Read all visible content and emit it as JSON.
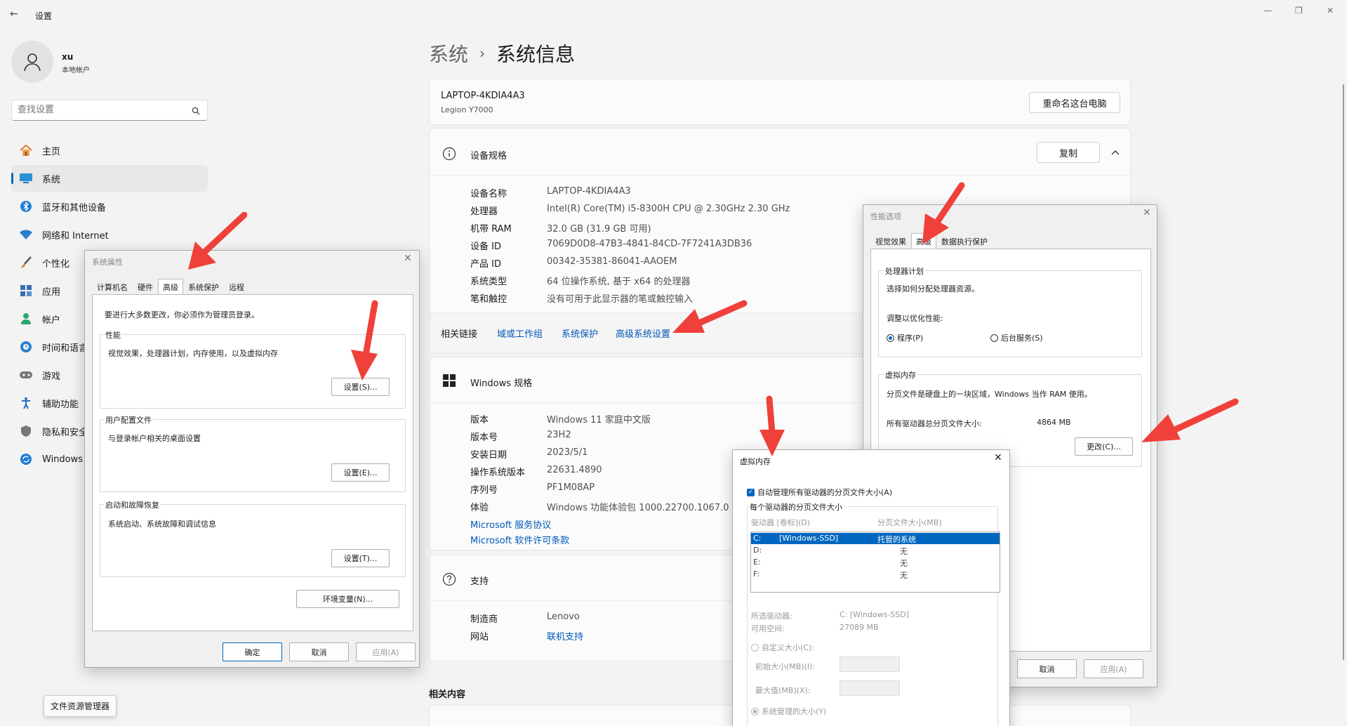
{
  "window": {
    "title": "设置",
    "back": "←",
    "minimize": "—",
    "maximize": "❐",
    "close": "✕"
  },
  "user": {
    "name": "xu",
    "account_type": "本地帐户"
  },
  "search": {
    "placeholder": "查找设置"
  },
  "sidebar": {
    "items": [
      {
        "label": "主页",
        "icon": "home-icon"
      },
      {
        "label": "系统",
        "icon": "monitor-icon"
      },
      {
        "label": "蓝牙和其他设备",
        "icon": "bluetooth-icon"
      },
      {
        "label": "网络和 Internet",
        "icon": "wifi-icon"
      },
      {
        "label": "个性化",
        "icon": "brush-icon"
      },
      {
        "label": "应用",
        "icon": "apps-icon"
      },
      {
        "label": "帐户",
        "icon": "person-icon"
      },
      {
        "label": "时间和语言",
        "icon": "globe-clock-icon"
      },
      {
        "label": "游戏",
        "icon": "gamepad-icon"
      },
      {
        "label": "辅助功能",
        "icon": "accessibility-icon"
      },
      {
        "label": "隐私和安全",
        "icon": "shield-icon"
      },
      {
        "label": "Windows",
        "icon": "update-icon"
      }
    ]
  },
  "breadcrumb": {
    "parent": "系统",
    "sep": "›",
    "current": "系统信息"
  },
  "device_card": {
    "name": "LAPTOP-4KDIA4A3",
    "model": "Legion Y7000",
    "rename_button": "重命名这台电脑"
  },
  "device_specs": {
    "title": "设备规格",
    "copy_button": "复制",
    "rows": [
      {
        "label": "设备名称",
        "value": "LAPTOP-4KDIA4A3"
      },
      {
        "label": "处理器",
        "value": "Intel(R) Core(TM) i5-8300H CPU @ 2.30GHz   2.30 GHz"
      },
      {
        "label": "机带 RAM",
        "value": "32.0 GB (31.9 GB 可用)"
      },
      {
        "label": "设备 ID",
        "value": "7069D0D8-47B3-4841-84CD-7F7241A3DB36"
      },
      {
        "label": "产品 ID",
        "value": "00342-35381-86041-AAOEM"
      },
      {
        "label": "系统类型",
        "value": "64 位操作系统, 基于 x64 的处理器"
      },
      {
        "label": "笔和触控",
        "value": "没有可用于此显示器的笔或触控输入"
      }
    ],
    "related_links_label": "相关链接",
    "related_links": [
      "域或工作组",
      "系统保护",
      "高级系统设置"
    ]
  },
  "windows_specs": {
    "title": "Windows 规格",
    "rows": [
      {
        "label": "版本",
        "value": "Windows 11 家庭中文版"
      },
      {
        "label": "版本号",
        "value": "23H2"
      },
      {
        "label": "安装日期",
        "value": "2023/5/1"
      },
      {
        "label": "操作系统版本",
        "value": "22631.4890"
      },
      {
        "label": "序列号",
        "value": "PF1M08AP"
      },
      {
        "label": "体验",
        "value": "Windows 功能体验包 1000.22700.1067.0"
      }
    ],
    "links": [
      "Microsoft 服务协议",
      "Microsoft 软件许可条款"
    ]
  },
  "support": {
    "title": "支持",
    "rows": [
      {
        "label": "制造商",
        "value": "Lenovo"
      },
      {
        "label": "网站",
        "value": "联机支持"
      }
    ]
  },
  "related_content": {
    "title": "相关内容"
  },
  "tooltip": "文件资源管理器",
  "sys_props": {
    "title": "系统属性",
    "tabs": [
      "计算机名",
      "硬件",
      "高级",
      "系统保护",
      "远程"
    ],
    "admin_note": "要进行大多数更改，你必须作为管理员登录。",
    "perf": {
      "label": "性能",
      "desc": "视觉效果，处理器计划，内存使用，以及虚拟内存",
      "button": "设置(S)..."
    },
    "profile": {
      "label": "用户配置文件",
      "desc": "与登录帐户相关的桌面设置",
      "button": "设置(E)..."
    },
    "startup": {
      "label": "启动和故障恢复",
      "desc": "系统启动、系统故障和调试信息",
      "button": "设置(T)..."
    },
    "env_button": "环境变量(N)...",
    "ok": "确定",
    "cancel": "取消",
    "apply": "应用(A)"
  },
  "perf_opts": {
    "title": "性能选项",
    "tabs": [
      "视觉效果",
      "高级",
      "数据执行保护"
    ],
    "cpu": {
      "label": "处理器计划",
      "desc": "选择如何分配处理器资源。",
      "adjust": "调整以优化性能:",
      "opt1": "程序(P)",
      "opt2": "后台服务(S)"
    },
    "vm": {
      "label": "虚拟内存",
      "desc": "分页文件是硬盘上的一块区域，Windows 当作 RAM 使用。",
      "total_label": "所有驱动器总分页文件大小:",
      "total_value": "4864 MB",
      "change": "更改(C)..."
    },
    "cancel": "取消",
    "apply": "应用(A)"
  },
  "vmem": {
    "title": "虚拟内存",
    "auto": "自动管理所有驱动器的分页文件大小(A)",
    "per_drive": "每个驱动器的分页文件大小",
    "col_drive": "驱动器 [卷标](D)",
    "col_size": "分页文件大小(MB)",
    "drives": [
      {
        "drive": "C:",
        "label": "[Windows-SSD]",
        "size": "托管的系统"
      },
      {
        "drive": "D:",
        "label": "",
        "size": "无"
      },
      {
        "drive": "E:",
        "label": "",
        "size": "无"
      },
      {
        "drive": "F:",
        "label": "",
        "size": "无"
      }
    ],
    "sel_drive_label": "所选驱动器:",
    "sel_drive_value": "C:  [Windows-SSD]",
    "free_label": "可用空间:",
    "free_value": "27089 MB",
    "custom": "自定义大小(C):",
    "initial": "初始大小(MB)(I):",
    "max": "最大值(MB)(X):",
    "system": "系统管理的大小(Y)"
  },
  "colors": {
    "accent": "#0067c0",
    "arrow": "#f0403a",
    "link": "#0058b8"
  }
}
